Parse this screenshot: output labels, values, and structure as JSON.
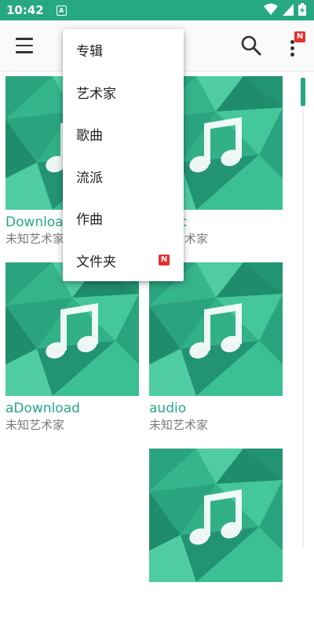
{
  "status_bar": {
    "time": "10:42",
    "notification_glyph": "A",
    "icons": [
      "wifi-icon",
      "signal-icon",
      "battery-charging-icon"
    ]
  },
  "toolbar": {
    "menu_icon": "hamburger-menu-icon",
    "search_icon": "search-icon",
    "more_icon": "overflow-menu-icon",
    "more_badge": "N"
  },
  "dropdown": {
    "items": [
      {
        "label": "专辑"
      },
      {
        "label": "艺术家"
      },
      {
        "label": "歌曲"
      },
      {
        "label": "流派"
      },
      {
        "label": "作曲"
      },
      {
        "label": "文件夹",
        "badge": "N"
      }
    ]
  },
  "albums": [
    {
      "title": "Download",
      "artist": "未知艺术家"
    },
    {
      "title": "Music",
      "artist": "未知艺术家"
    },
    {
      "title": "aDownload",
      "artist": "未知艺术家"
    },
    {
      "title": "audio",
      "artist": "未知艺术家"
    },
    {
      "title": "",
      "artist": ""
    }
  ],
  "colors": {
    "accent": "#26a883",
    "status_bar": "#26a883",
    "badge": "#e62e2e"
  },
  "scrollbar": {
    "position": 0.0
  }
}
